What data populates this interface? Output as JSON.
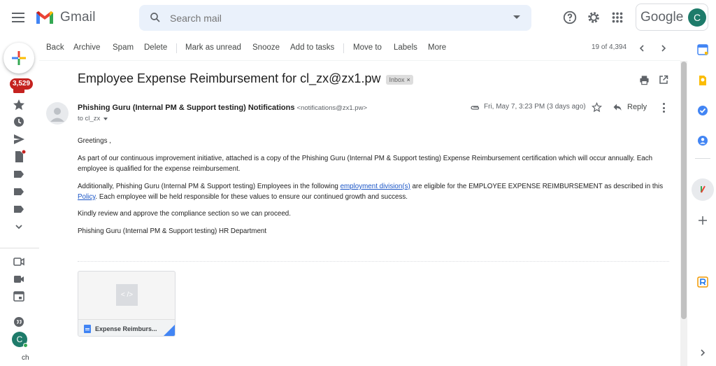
{
  "app": {
    "name": "Gmail",
    "brand_word": "Google",
    "account_initial": "C"
  },
  "search": {
    "placeholder": "Search mail"
  },
  "left_rail": {
    "inbox_count": "3,529",
    "avatar_initial": "C",
    "truncated_label": "ch"
  },
  "toolbar": {
    "back": "Back",
    "archive": "Archive",
    "spam": "Spam",
    "delete": "Delete",
    "mark_unread": "Mark as unread",
    "snooze": "Snooze",
    "add_to_tasks": "Add to tasks",
    "move_to": "Move to",
    "labels": "Labels",
    "more": "More",
    "pagination": "19 of 4,394"
  },
  "email": {
    "subject": "Employee Expense Reimbursement for cl_zx@zx1.pw",
    "label_chip": "Inbox",
    "label_close": "×",
    "sender_name": "Phishing Guru (Internal PM & Support testing) Notifications",
    "sender_email": "<notifications@zx1.pw>",
    "to_line": "to cl_zx",
    "date": "Fri, May 7, 3:23 PM (3 days ago)",
    "reply": "Reply",
    "body": {
      "greeting": "Greetings ,",
      "para1": "As part of our continuous improvement initiative, attached is a copy of the Phishing Guru (Internal PM & Support testing) Expense Reimbursement certification which will occur annually. Each employee is qualified for the expense reimbursement.",
      "para2_before": "Additionally, Phishing Guru (Internal PM & Support testing) Employees in the following ",
      "para2_link": "employment division(s)",
      "para2_middle": " are eligible for the EMPLOYEE EXPENSE REIMBURSEMENT as described in this ",
      "para2_link2": "Policy",
      "para2_after": ". Each employee will be held responsible for these values to ensure our continued growth and success.",
      "para3": "Kindly review and approve the compliance section so we can proceed.",
      "signature": "Phishing Guru (Internal PM & Support testing) HR Department"
    },
    "attachment": {
      "preview_glyph": "< />",
      "name": "Expense Reimburs..."
    }
  },
  "colors": {
    "accent_blue": "#1a55c6",
    "badge_red": "#c5221f",
    "avatar_green": "#1e7b6a",
    "search_bg": "#eaf1fb"
  },
  "icons": [
    "hamburger-icon",
    "gmail-logo-icon",
    "search-icon",
    "help-icon",
    "settings-icon",
    "apps-icon",
    "compose-icon",
    "inbox-icon",
    "star-icon",
    "clock-icon",
    "send-icon",
    "draft-icon",
    "label-icon",
    "chevron-down-icon",
    "meet-icon",
    "video-icon",
    "calendar-icon",
    "chat-icon",
    "print-icon",
    "open-new-window-icon",
    "attachment-icon",
    "reply-icon",
    "more-vert-icon",
    "calendar-app-icon",
    "keep-icon",
    "tasks-icon",
    "contacts-icon",
    "addon-icon",
    "add-icon",
    "addon-r-icon",
    "chevron-right-icon"
  ]
}
